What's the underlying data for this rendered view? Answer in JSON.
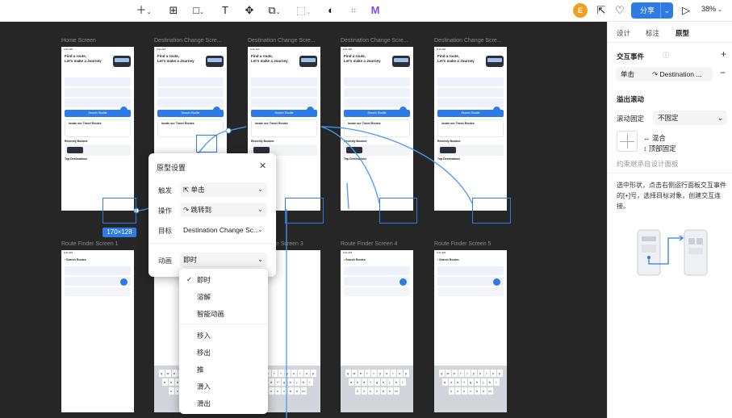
{
  "toolbar": {
    "share_label": "分享",
    "zoom": "38%",
    "avatar_letter": "E",
    "colors": {
      "accent": "#2f7be5",
      "avatar": "#f0a020"
    }
  },
  "frames": [
    {
      "title": "Home Screen"
    },
    {
      "title": "Destination Change Scre..."
    },
    {
      "title": "Destination Change Scre..."
    },
    {
      "title": "Destination Change Scre..."
    },
    {
      "title": "Destination Change Scre..."
    },
    {
      "title": "Route Finder Screen 1"
    },
    {
      "title": "ler Screen 3"
    },
    {
      "title": "Route Finder Screen 4"
    },
    {
      "title": "Route Finder Screen 5"
    }
  ],
  "phone": {
    "hero": "Find a route,\nLet's make a Journey",
    "search_btn": "Search Shuttle",
    "locate": "locate our Travel Routes",
    "recently": "Recently Booked",
    "top_dest": "Top Destinations",
    "search_routes": "Search Routes",
    "book_again": "BOOK AGAIN",
    "space": "space",
    "return": "return"
  },
  "keyboard": {
    "row1": [
      "q",
      "w",
      "e",
      "r",
      "t",
      "y",
      "u",
      "i",
      "o",
      "p"
    ],
    "row2": [
      "a",
      "s",
      "d",
      "f",
      "g",
      "h",
      "j",
      "k",
      "l"
    ],
    "row3": [
      "z",
      "x",
      "c",
      "v",
      "b",
      "n",
      "m"
    ]
  },
  "size_badge": "170×128",
  "popup": {
    "title": "原型设置",
    "trigger_label": "触发",
    "trigger_value": "单击",
    "action_label": "操作",
    "action_value": "跳转到",
    "target_label": "目标",
    "target_value": "Destination Change Sc...",
    "anim_label": "动画",
    "anim_value": "即时"
  },
  "dropdown": {
    "group1": [
      "即时",
      "溶解",
      "智能动画"
    ],
    "group2": [
      "移入",
      "移出",
      "推",
      "滑入",
      "滑出"
    ],
    "selected": "即时"
  },
  "right_panel": {
    "tabs": [
      "设计",
      "标注",
      "原型"
    ],
    "active_tab": "原型",
    "interaction_title": "交互事件",
    "event_trigger": "单击",
    "event_target": "Destination ...",
    "overflow_title": "溢出滚动",
    "scroll_fixed_label": "滚动固定",
    "scroll_fixed_value": "不固定",
    "mix_label": "混合",
    "top_fixed_label": "顶部固定",
    "inherit_text": "约束继承自设计面板",
    "hint": "选中形状，点击右侧运行面板交互事件的[+]号，选择目标对象，创建交互连接。"
  }
}
